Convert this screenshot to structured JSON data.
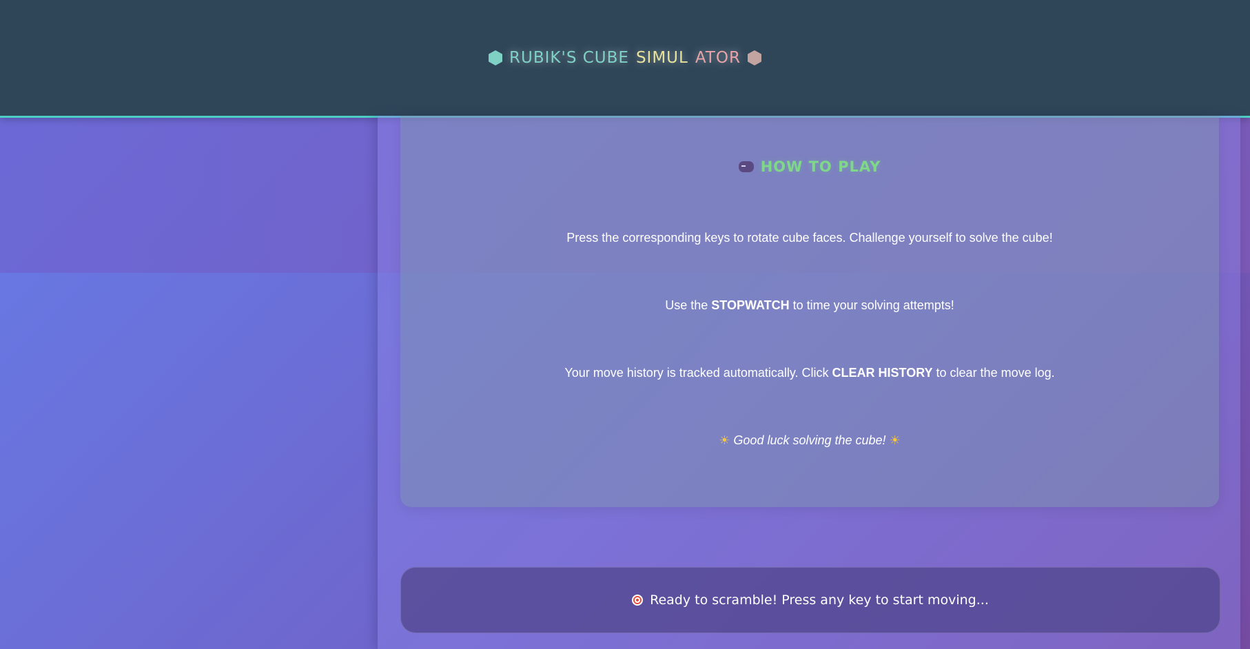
{
  "header": {
    "title_part1": "RUBIK'S CUBE ",
    "title_part2": "SIMUL",
    "title_part3": "ATOR",
    "left_icon": "hexagon-icon",
    "right_icon": "hexagon-icon",
    "accent_color": "#4ecdc4"
  },
  "how_to_play": {
    "icon": "gamepad-icon",
    "title": "HOW TO PLAY",
    "line1": "Press the corresponding keys to rotate cube faces. Challenge yourself to solve the cube!",
    "line2_prefix": "Use the ",
    "line2_bold": "STOPWATCH",
    "line2_suffix": " to time your solving attempts!",
    "line3_prefix": "Your move history is tracked automatically. Click ",
    "line3_bold": "CLEAR HISTORY",
    "line3_suffix": " to clear the move log.",
    "line4_sun_left": "☀",
    "line4_text": "Good luck solving the cube!",
    "line4_sun_right": "☀"
  },
  "status": {
    "icon": "target-icon",
    "message": "Ready to scramble! Press any key to start moving..."
  }
}
